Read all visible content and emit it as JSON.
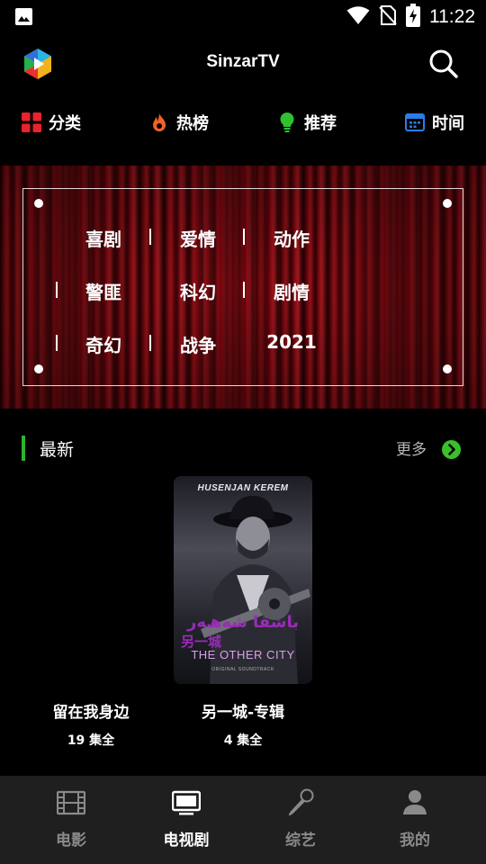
{
  "status_bar": {
    "time": "11:22",
    "icons": [
      "image-icon",
      "wifi-icon",
      "no-sim-icon",
      "battery-charging-icon"
    ]
  },
  "app_bar": {
    "title": "SinzarTV",
    "logo_icon": "play-logo-icon",
    "search_icon": "search-icon"
  },
  "categories": [
    {
      "label": "分类",
      "icon": "grid-icon",
      "color": "#e8232b"
    },
    {
      "label": "热榜",
      "icon": "flame-icon",
      "color": "#f0622a"
    },
    {
      "label": "推荐",
      "icon": "lightbulb-icon",
      "color": "#2fc12f"
    },
    {
      "label": "时间",
      "icon": "calendar-icon",
      "color": "#2b7de8"
    }
  ],
  "banner": {
    "genres": [
      "喜剧",
      "爱情",
      "动作",
      "警匪",
      "科幻",
      "剧情",
      "奇幻",
      "战争",
      "2021"
    ]
  },
  "latest": {
    "title": "最新",
    "more_label": "更多",
    "accent": "#2db52b",
    "items": [
      {
        "title": "留在我身边",
        "subtitle": "19 集全"
      },
      {
        "title": "另一城-专辑",
        "subtitle": "4 集全",
        "poster": {
          "artist": "HUSENJAN KEREM",
          "script_title": "ﺑﺎﺷﻘﺎ ﺷﻪھﻪﺭ",
          "cn_title": "另一城",
          "en_title": "THE OTHER CITY",
          "tag": "ORIGINAL SOUNDTRACK"
        }
      }
    ]
  },
  "bottom_nav": {
    "items": [
      {
        "label": "电影",
        "icon": "film-icon",
        "active": false
      },
      {
        "label": "电视剧",
        "icon": "tv-icon",
        "active": true
      },
      {
        "label": "综艺",
        "icon": "microphone-icon",
        "active": false
      },
      {
        "label": "我的",
        "icon": "person-icon",
        "active": false
      }
    ]
  }
}
